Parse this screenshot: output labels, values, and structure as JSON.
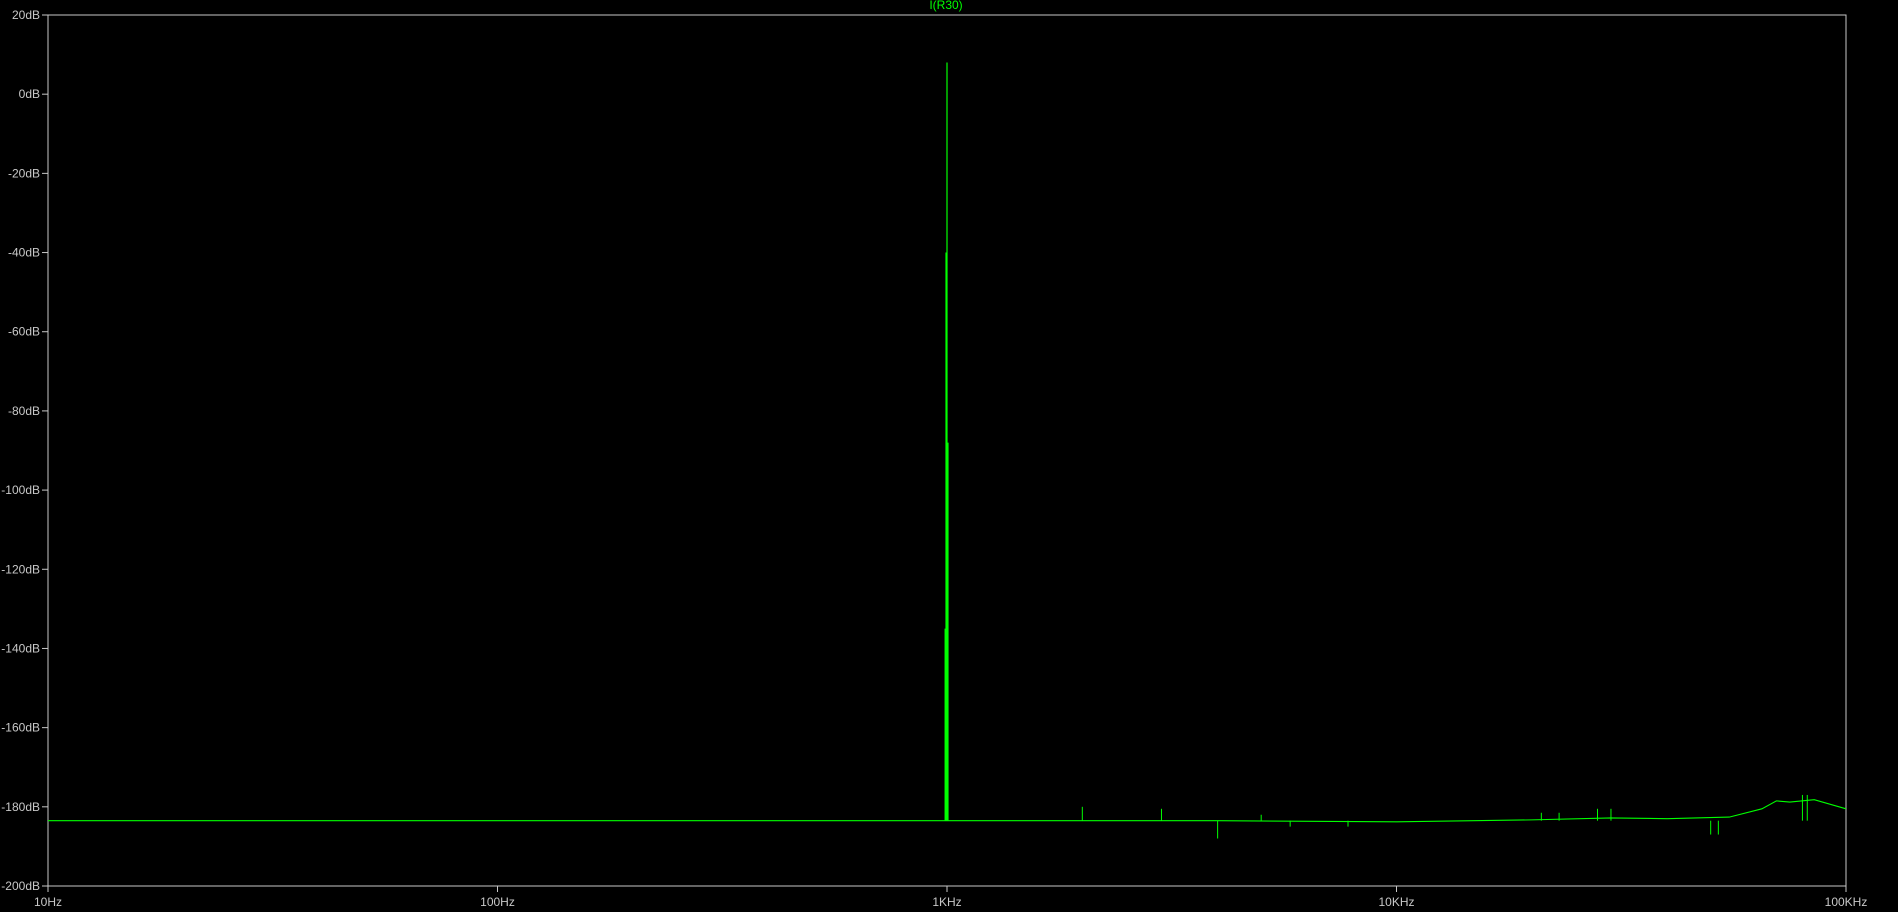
{
  "chart_data": {
    "type": "line",
    "title": "I(R30)",
    "x_scale": "log",
    "xlim": [
      10,
      100000
    ],
    "ylim": [
      -200,
      20
    ],
    "x_ticks": [
      {
        "value": 10,
        "label": "10Hz"
      },
      {
        "value": 100,
        "label": "100Hz"
      },
      {
        "value": 1000,
        "label": "1KHz"
      },
      {
        "value": 10000,
        "label": "10KHz"
      },
      {
        "value": 100000,
        "label": "100KHz"
      }
    ],
    "y_ticks": [
      {
        "value": 20,
        "label": "20dB"
      },
      {
        "value": 0,
        "label": "0dB"
      },
      {
        "value": -20,
        "label": "-20dB"
      },
      {
        "value": -40,
        "label": "-40dB"
      },
      {
        "value": -60,
        "label": "-60dB"
      },
      {
        "value": -80,
        "label": "-80dB"
      },
      {
        "value": -100,
        "label": "-100dB"
      },
      {
        "value": -120,
        "label": "-120dB"
      },
      {
        "value": -140,
        "label": "-140dB"
      },
      {
        "value": -160,
        "label": "-160dB"
      },
      {
        "value": -180,
        "label": "-180dB"
      },
      {
        "value": -200,
        "label": "-200dB"
      }
    ],
    "grid": false,
    "colors": {
      "background": "#000000",
      "frame": "#c8c8c8",
      "series": "#00ff00"
    },
    "series": [
      {
        "points": [
          [
            10,
            -183.5
          ],
          [
            1000,
            -183.5
          ],
          [
            4000,
            -183.5
          ],
          [
            10000,
            -183.8
          ],
          [
            20000,
            -183.3
          ],
          [
            30000,
            -182.8
          ],
          [
            40000,
            -183.0
          ],
          [
            55000,
            -182.6
          ],
          [
            65000,
            -180.5
          ],
          [
            70000,
            -178.5
          ],
          [
            75000,
            -178.8
          ],
          [
            85000,
            -178.2
          ],
          [
            100000,
            -180.5
          ]
        ],
        "spikes": [
          {
            "x": 1000,
            "y": 8
          },
          {
            "x": 995,
            "y": -40
          },
          {
            "x": 1005,
            "y": -88
          },
          {
            "x": 990,
            "y": -135
          },
          {
            "x": 2000,
            "y": -180
          },
          {
            "x": 3000,
            "y": -180.5
          },
          {
            "x": 4000,
            "y": -188
          },
          {
            "x": 5000,
            "y": -182
          },
          {
            "x": 5800,
            "y": -185
          },
          {
            "x": 7800,
            "y": -185
          },
          {
            "x": 21000,
            "y": -181.5
          },
          {
            "x": 23000,
            "y": -181.5
          },
          {
            "x": 28000,
            "y": -180.5
          },
          {
            "x": 30000,
            "y": -180.5
          },
          {
            "x": 50000,
            "y": -187
          },
          {
            "x": 52000,
            "y": -187
          },
          {
            "x": 80000,
            "y": -177
          },
          {
            "x": 82000,
            "y": -177
          }
        ]
      }
    ]
  }
}
